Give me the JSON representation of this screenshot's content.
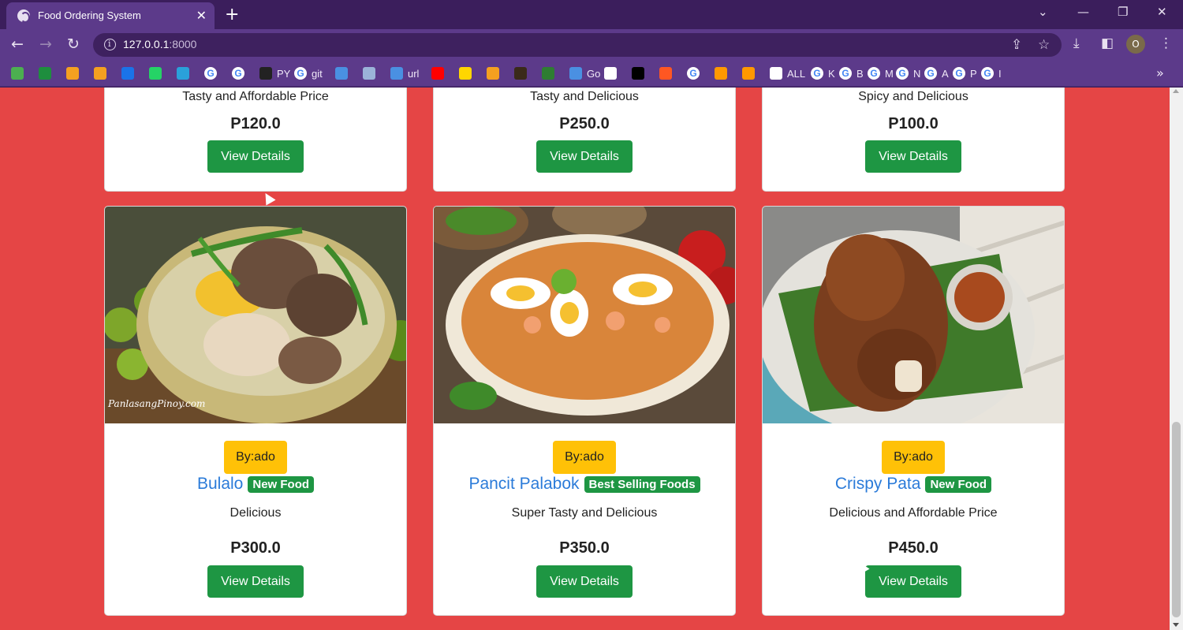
{
  "browser": {
    "tab_title": "Food Ordering System",
    "url_host": "127.0.0.1",
    "url_port": ":8000",
    "profile_initial": "O",
    "bookmarks": [
      {
        "label": "",
        "color": "#4caf50"
      },
      {
        "label": "",
        "color": "#1e8e3e"
      },
      {
        "label": "",
        "color": "#f4a020"
      },
      {
        "label": "",
        "color": "#f4a020"
      },
      {
        "label": "",
        "color": "#1a73e8"
      },
      {
        "label": "",
        "color": "#25d366"
      },
      {
        "label": "",
        "color": "#2aa1da"
      },
      {
        "label": "",
        "g": true
      },
      {
        "label": "",
        "g": true
      },
      {
        "label": "PY",
        "color": "#222222"
      },
      {
        "label": "git",
        "g": true
      },
      {
        "label": "",
        "color": "#4a90e2"
      },
      {
        "label": "",
        "color": "#9bb3d8"
      },
      {
        "label": "url",
        "color": "#4a90e2"
      },
      {
        "label": "",
        "color": "#ff0000"
      },
      {
        "label": "",
        "color": "#ffd600"
      },
      {
        "label": "",
        "color": "#f4a020"
      },
      {
        "label": "",
        "color": "#3a2a1a"
      },
      {
        "label": "",
        "color": "#2e7d32"
      },
      {
        "label": "Go",
        "color": "#4a90e2"
      },
      {
        "label": "",
        "color": "#ffffff"
      },
      {
        "label": "",
        "color": "#000000"
      },
      {
        "label": "",
        "color": "#ff5722"
      },
      {
        "label": "",
        "g": true
      },
      {
        "label": "",
        "color": "#ff9800"
      },
      {
        "label": "",
        "color": "#ff9800"
      },
      {
        "label": "ALL",
        "color": "#ffffff"
      },
      {
        "label": "K",
        "g": true
      },
      {
        "label": "B",
        "g": true
      },
      {
        "label": "M",
        "g": true
      },
      {
        "label": "N",
        "g": true
      },
      {
        "label": "A",
        "g": true
      },
      {
        "label": "P",
        "g": true
      },
      {
        "label": "I",
        "g": true
      }
    ]
  },
  "top_cards": [
    {
      "description": "Tasty and Affordable Price",
      "price": "P120.0",
      "button": "View Details"
    },
    {
      "description": "Tasty and Delicious",
      "price": "P250.0",
      "button": "View Details"
    },
    {
      "description": "Spicy and Delicious",
      "price": "P100.0",
      "button": "View Details"
    }
  ],
  "bottom_cards": [
    {
      "author": "By:ado",
      "name": "Bulalo",
      "tag": "New Food",
      "description": "Delicious",
      "price": "P300.0",
      "button": "View Details",
      "watermark": "PanlasangPinoy.com"
    },
    {
      "author": "By:ado",
      "name": "Pancit Palabok",
      "tag": "Best Selling Foods",
      "description": "Super Tasty and Delicious",
      "price": "P350.0",
      "button": "View Details"
    },
    {
      "author": "By:ado",
      "name": "Crispy Pata",
      "tag": "New Food",
      "description": "Delicious and Affordable Price",
      "price": "P450.0",
      "button": "View Details"
    }
  ],
  "colors": {
    "page_background": "#e54545",
    "button_green": "#1e9643",
    "author_badge": "#ffc107",
    "food_name_blue": "#2b7bd9",
    "browser_frame": "#5c3a8a"
  }
}
